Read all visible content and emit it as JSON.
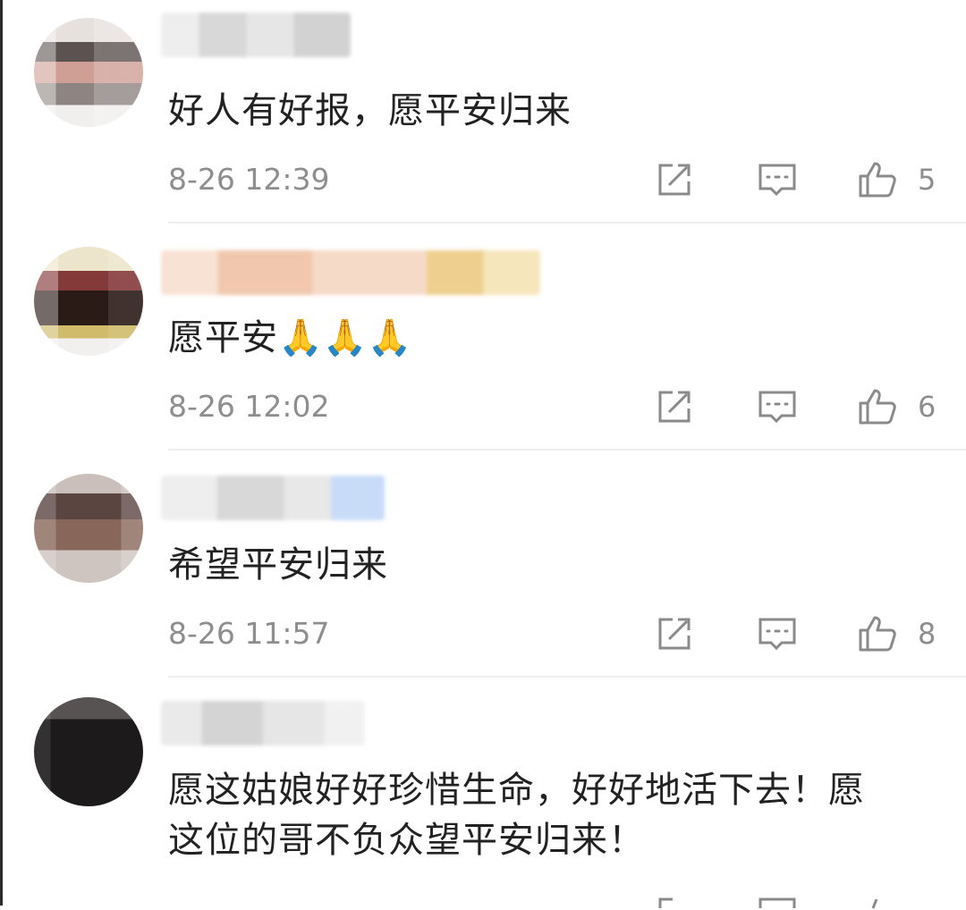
{
  "comments": [
    {
      "text": "好人有好报，愿平安归来",
      "time": "8-26 12:39",
      "likes": "5",
      "name_blur_colors": [
        "#e9e9e9",
        "#d6d6d6",
        "#e3e3e3"
      ]
    },
    {
      "text": "愿平安",
      "emoji": "🙏🙏🙏",
      "time": "8-26 12:02",
      "likes": "6",
      "name_blur_colors": [
        "#f7d7c4",
        "#f2c8ac",
        "#f4e1a4"
      ]
    },
    {
      "text": "希望平安归来",
      "time": "8-26 11:57",
      "likes": "8",
      "name_blur_colors": [
        "#eaeaea",
        "#dcdcdc",
        "#cfe0f8"
      ]
    },
    {
      "text": "愿这姑娘好好珍惜生命，好好地活下去！愿这位的哥不负众望平安归来！",
      "name_blur_colors": [
        "#e6e6e6",
        "#d9d9d9",
        "#ededed"
      ]
    }
  ],
  "icons": {
    "repost": "repost-icon",
    "comment": "comment-icon",
    "like": "thumbs-up-icon"
  },
  "colors": {
    "text": "#222222",
    "meta": "#8e8e8e",
    "divider": "#eeeeee",
    "icon": "#8a8a8a"
  }
}
